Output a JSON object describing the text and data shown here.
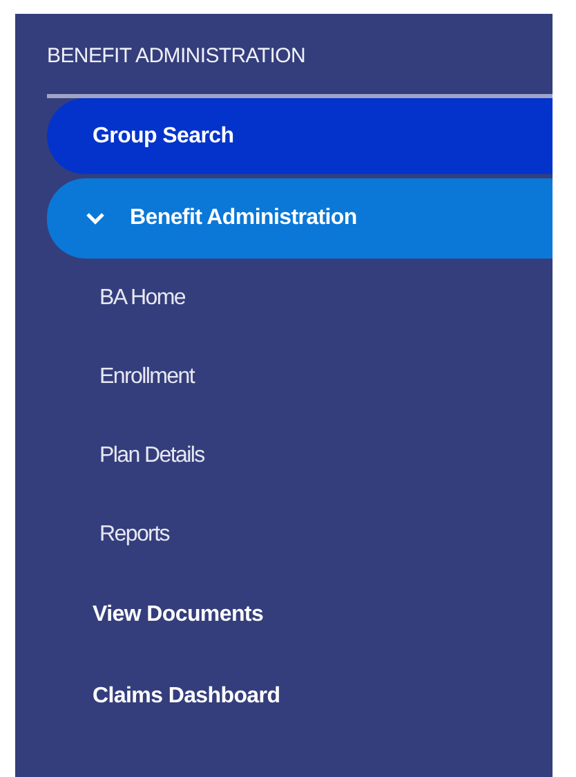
{
  "sidebar": {
    "title": "BENEFIT ADMINISTRATION",
    "items": [
      {
        "kind": "link",
        "label": "Group Search",
        "selected": true
      },
      {
        "kind": "group",
        "label": "Benefit Administration",
        "expanded": true,
        "children": [
          {
            "label": "BA Home",
            "selected": false
          },
          {
            "label": "Enrollment",
            "selected": false
          },
          {
            "label": "Plan Details",
            "selected": false
          },
          {
            "label": "Reports",
            "selected": false
          }
        ]
      },
      {
        "kind": "link",
        "label": "View Documents",
        "selected": false
      },
      {
        "kind": "link",
        "label": "Claims Dashboard",
        "selected": false
      }
    ]
  }
}
